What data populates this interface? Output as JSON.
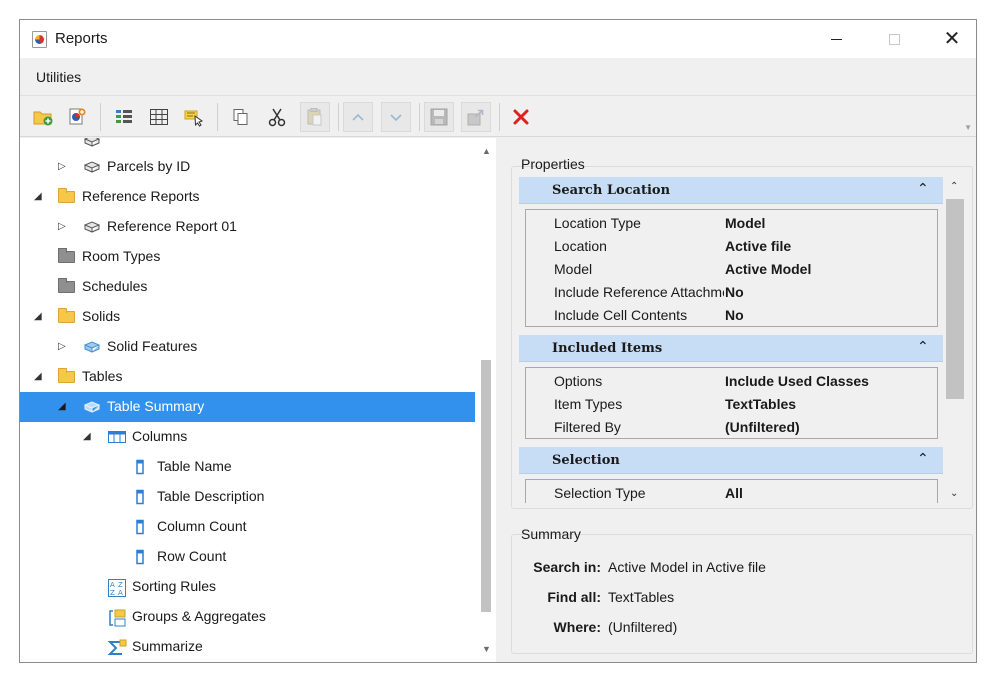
{
  "window": {
    "title": "Reports"
  },
  "menu": {
    "utilities": "Utilities"
  },
  "toolbar": {
    "buttons": [
      {
        "name": "new-folder",
        "icon": "folder-add-icon"
      },
      {
        "name": "new-report",
        "icon": "report-add-icon"
      },
      {
        "name": "columns",
        "icon": "column-list-icon"
      },
      {
        "name": "table",
        "icon": "table-grid-icon"
      },
      {
        "name": "select",
        "icon": "select-highlight-icon"
      },
      {
        "name": "copy",
        "icon": "copy-icon"
      },
      {
        "name": "cut",
        "icon": "scissors-icon"
      },
      {
        "name": "paste",
        "icon": "paste-icon"
      },
      {
        "name": "move-up",
        "icon": "chevron-up-icon"
      },
      {
        "name": "move-down",
        "icon": "chevron-down-icon"
      },
      {
        "name": "save",
        "icon": "save-icon"
      },
      {
        "name": "export",
        "icon": "export-icon"
      },
      {
        "name": "delete",
        "icon": "delete-x-icon"
      }
    ],
    "delete_color": "#e0201b"
  },
  "tree": {
    "items": [
      {
        "label": "Parcels by ID",
        "level": 1,
        "expander": "collapsed",
        "icon": "report-definition-icon"
      },
      {
        "label": "Reference Reports",
        "level": 0,
        "expander": "expanded",
        "icon": "folder-yellow-icon"
      },
      {
        "label": "Reference Report 01",
        "level": 1,
        "expander": "collapsed",
        "icon": "report-definition-icon"
      },
      {
        "label": "Room Types",
        "level": 0,
        "expander": "none",
        "icon": "folder-gray-icon"
      },
      {
        "label": "Schedules",
        "level": 0,
        "expander": "none",
        "icon": "folder-gray-icon"
      },
      {
        "label": "Solids",
        "level": 0,
        "expander": "expanded",
        "icon": "folder-yellow-icon"
      },
      {
        "label": "Solid Features",
        "level": 1,
        "expander": "collapsed",
        "icon": "report-blue-icon"
      },
      {
        "label": "Tables",
        "level": 0,
        "expander": "expanded",
        "icon": "folder-yellow-icon"
      },
      {
        "label": "Table Summary",
        "level": 1,
        "expander": "expanded",
        "icon": "report-blue-icon",
        "selected": true
      },
      {
        "label": "Columns",
        "level": 2,
        "expander": "expanded",
        "icon": "columns-icon"
      },
      {
        "label": "Table Name",
        "level": 3,
        "expander": "none",
        "icon": "column-item-icon"
      },
      {
        "label": "Table Description",
        "level": 3,
        "expander": "none",
        "icon": "column-item-icon"
      },
      {
        "label": "Column Count",
        "level": 3,
        "expander": "none",
        "icon": "column-item-icon"
      },
      {
        "label": "Row Count",
        "level": 3,
        "expander": "none",
        "icon": "column-item-icon"
      },
      {
        "label": "Sorting Rules",
        "level": 2,
        "expander": "none",
        "icon": "sort-az-icon"
      },
      {
        "label": "Groups & Aggregates",
        "level": 2,
        "expander": "none",
        "icon": "groups-icon"
      },
      {
        "label": "Summarize",
        "level": 2,
        "expander": "none",
        "icon": "sigma-icon"
      }
    ],
    "selected_color": "#3391ee"
  },
  "properties": {
    "title": "Properties",
    "categories": [
      {
        "label": "Search Location",
        "rows": [
          {
            "key": "Location Type",
            "value": "Model"
          },
          {
            "key": "Location",
            "value": "Active file"
          },
          {
            "key": "Model",
            "value": "Active Model"
          },
          {
            "key": "Include Reference Attachments",
            "value": "No"
          },
          {
            "key": "Include Cell Contents",
            "value": "No"
          }
        ]
      },
      {
        "label": "Included Items",
        "rows": [
          {
            "key": "Options",
            "value": "Include Used Classes"
          },
          {
            "key": "Item Types",
            "value": "TextTables"
          },
          {
            "key": "Filtered By",
            "value": "(Unfiltered)"
          }
        ]
      },
      {
        "label": "Selection",
        "rows": [
          {
            "key": "Selection Type",
            "value": "All"
          }
        ]
      }
    ],
    "header_color": "#c7dcf5"
  },
  "summary": {
    "title": "Summary",
    "rows": [
      {
        "key": "Search in:",
        "value": "Active Model  in Active file"
      },
      {
        "key": "Find all:",
        "value": "TextTables"
      },
      {
        "key": "Where:",
        "value": "(Unfiltered)"
      }
    ]
  }
}
